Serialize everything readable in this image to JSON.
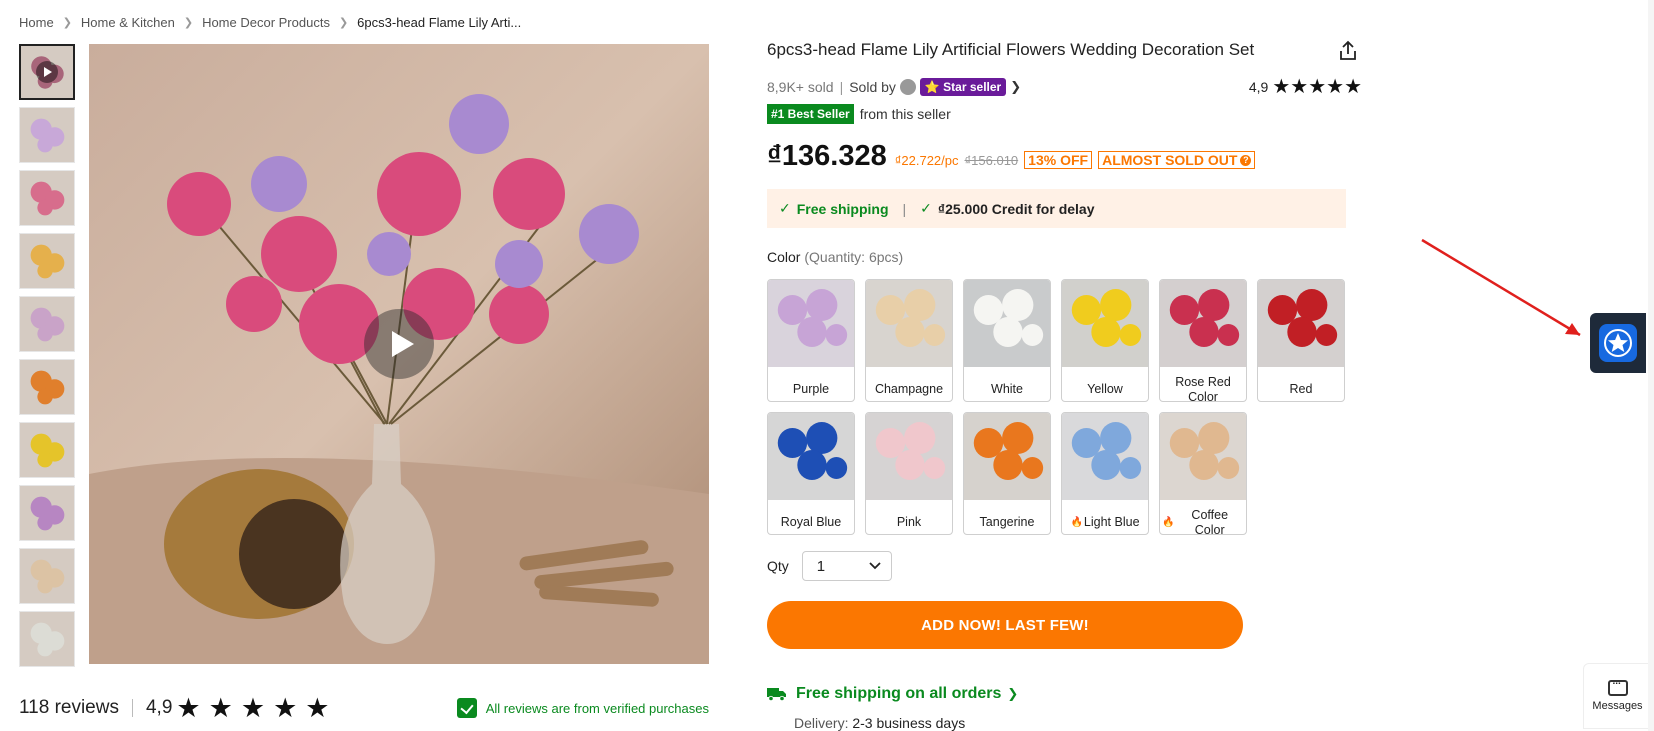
{
  "breadcrumb": {
    "items": [
      "Home",
      "Home & Kitchen",
      "Home Decor Products"
    ],
    "current": "6pcs3-head Flame Lily Arti..."
  },
  "gallery": {
    "thumbnails": [
      {
        "name": "video",
        "color": "#a8657a",
        "has_play": true
      },
      {
        "name": "purple",
        "color": "#c8a8d8"
      },
      {
        "name": "rose",
        "color": "#d76d8c"
      },
      {
        "name": "mixed",
        "color": "#e5b04c"
      },
      {
        "name": "lavender",
        "color": "#c9a3c8"
      },
      {
        "name": "orange",
        "color": "#e07f2c"
      },
      {
        "name": "yellow",
        "color": "#e5c42a"
      },
      {
        "name": "purple2",
        "color": "#b786c2"
      },
      {
        "name": "champagne",
        "color": "#dcc3a4"
      },
      {
        "name": "white",
        "color": "#dcdcd5"
      }
    ]
  },
  "reviews": {
    "count": "118 reviews",
    "rating": "4,9",
    "verified": "All reviews are from verified purchases"
  },
  "product": {
    "title": "6pcs3-head Flame Lily Artificial Flowers Wedding Decoration Set",
    "sold": "8,9K+ sold",
    "sold_by": "Sold by",
    "star_seller": "⭐ Star seller",
    "rating": "4,9",
    "best_seller": "#1 Best Seller",
    "best_seller_suffix": "from this seller",
    "price": "₫136.328",
    "unit_price": "₫22.722/pc",
    "old_price": "₫156.010",
    "off": "13% OFF",
    "almost_sold_out": "ALMOST SOLD OUT"
  },
  "shipping": {
    "free": "Free shipping",
    "credit": "₫25.000 Credit for delay"
  },
  "color": {
    "label": "Color",
    "quantity": "(Quantity: 6pcs)",
    "options": [
      {
        "label": "Purple",
        "color": "#c7a4d6",
        "bg": "#d9d3dc",
        "hot": false
      },
      {
        "label": "Champagne",
        "color": "#e8cfa8",
        "bg": "#d8d4cf",
        "hot": false
      },
      {
        "label": "White",
        "color": "#f5f5f2",
        "bg": "#c9cbcc",
        "hot": false
      },
      {
        "label": "Yellow",
        "color": "#f0cc1e",
        "bg": "#d1d0cc",
        "hot": false
      },
      {
        "label": "Rose Red Color",
        "color": "#c9304f",
        "bg": "#d4cfcf",
        "hot": false
      },
      {
        "label": "Red",
        "color": "#c11f25",
        "bg": "#d4d0cf",
        "hot": false
      },
      {
        "label": "Royal Blue",
        "color": "#1e4fb5",
        "bg": "#d6d6d6",
        "hot": false
      },
      {
        "label": "Pink",
        "color": "#f0c7cc",
        "bg": "#d6d3d3",
        "hot": false
      },
      {
        "label": "Tangerine",
        "color": "#e9771e",
        "bg": "#d6d2cd",
        "hot": false
      },
      {
        "label": "Light Blue",
        "color": "#7fa8dc",
        "bg": "#d9d9db",
        "hot": true
      },
      {
        "label": "Coffee Color",
        "color": "#e0b890",
        "bg": "#dcd6d0",
        "hot": true
      }
    ]
  },
  "qty": {
    "label": "Qty",
    "value": "1"
  },
  "cta": {
    "add": "ADD NOW! LAST FEW!"
  },
  "free_shipping_orders": "Free shipping on all orders",
  "delivery": {
    "label": "Delivery:",
    "value": "2-3 business days"
  },
  "messages": "Messages",
  "colors": {
    "accent": "#fb7701",
    "green": "#0a8a1f",
    "star_seller": "#6a1b9a"
  }
}
